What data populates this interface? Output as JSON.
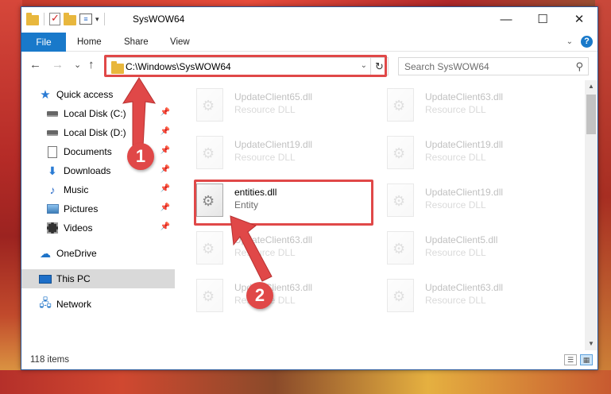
{
  "window": {
    "title": "SysWOW64",
    "controls": {
      "minimize": "—",
      "maximize": "☐",
      "close": "✕"
    }
  },
  "ribbon": {
    "tabs": [
      "File",
      "Home",
      "Share",
      "View"
    ],
    "help": "?"
  },
  "nav": {
    "back": "←",
    "forward": "→",
    "recent": "⌄",
    "up": "↑",
    "address": "C:\\Windows\\SysWOW64",
    "refresh": "↻",
    "search_placeholder": "Search SysWOW64"
  },
  "sidebar": {
    "items": [
      {
        "label": "Quick access",
        "icon": "star-icon",
        "pinned": false
      },
      {
        "label": "Local Disk (C:)",
        "icon": "drive-icon",
        "pinned": true
      },
      {
        "label": "Local Disk (D:)",
        "icon": "drive-icon",
        "pinned": true
      },
      {
        "label": "Documents",
        "icon": "documents-icon",
        "pinned": true
      },
      {
        "label": "Downloads",
        "icon": "downloads-icon",
        "pinned": true
      },
      {
        "label": "Music",
        "icon": "music-icon",
        "pinned": true
      },
      {
        "label": "Pictures",
        "icon": "pictures-icon",
        "pinned": true
      },
      {
        "label": "Videos",
        "icon": "videos-icon",
        "pinned": true
      },
      {
        "label": "OneDrive",
        "icon": "onedrive-icon",
        "pinned": false
      },
      {
        "label": "This PC",
        "icon": "this-pc-icon",
        "pinned": false,
        "selected": true
      },
      {
        "label": "Network",
        "icon": "network-icon",
        "pinned": false
      }
    ]
  },
  "files": [
    {
      "name": "UpdateClient65.dll",
      "type": "Resource DLL",
      "faded": true
    },
    {
      "name": "UpdateClient63.dll",
      "type": "Resource DLL",
      "faded": true
    },
    {
      "name": "UpdateClient19.dll",
      "type": "Resource DLL",
      "faded": true
    },
    {
      "name": "UpdateClient19.dll",
      "type": "Resource DLL",
      "faded": true
    },
    {
      "name": "entities.dll",
      "type": "Entity",
      "faded": false,
      "highlighted": true
    },
    {
      "name": "UpdateClient19.dll",
      "type": "Resource DLL",
      "faded": true
    },
    {
      "name": "UpdateClient63.dll",
      "type": "Resource DLL",
      "faded": true
    },
    {
      "name": "UpdateClient5.dll",
      "type": "Resource DLL",
      "faded": true
    },
    {
      "name": "UpdateClient63.dll",
      "type": "Resource DLL",
      "faded": true
    },
    {
      "name": "UpdateClient63.dll",
      "type": "Resource DLL",
      "faded": true
    }
  ],
  "status": {
    "item_count": "118 items"
  },
  "annotations": {
    "step1": "1",
    "step2": "2",
    "color": "#e04848"
  }
}
